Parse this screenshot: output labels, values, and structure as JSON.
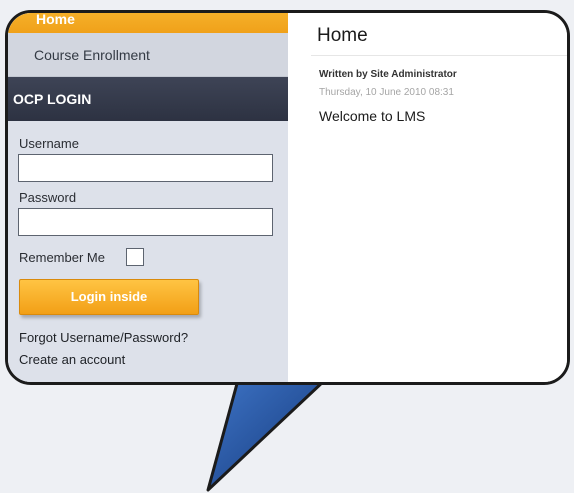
{
  "sidebar": {
    "menu": {
      "home_label": "Home",
      "course_label": "Course Enrollment"
    },
    "login": {
      "header": "OCP LOGIN",
      "username_label": "Username",
      "username_value": "",
      "password_label": "Password",
      "password_value": "",
      "remember_label": "Remember Me",
      "remember_checked": false,
      "submit_label": "Login inside",
      "forgot_link": "Forgot Username/Password?",
      "create_link": "Create an account"
    }
  },
  "content": {
    "title": "Home",
    "written_by": "Written by Site Administrator",
    "date": "Thursday, 10 June 2010 08:31",
    "body": "Welcome to LMS"
  },
  "colors": {
    "accent": "#f5a623",
    "header_dark": "#343a4a",
    "sidebar_bg": "#dde1ea",
    "tail_blue": "#1f4f9a"
  }
}
